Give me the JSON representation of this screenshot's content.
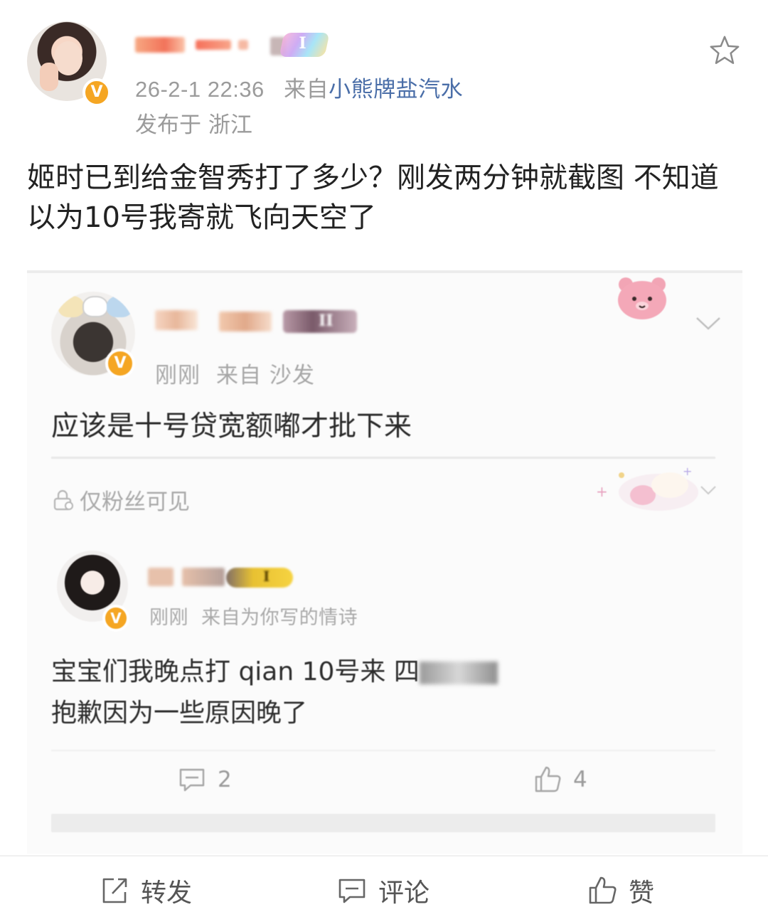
{
  "post": {
    "time": "26-2-1 22:36",
    "from_label": "来自",
    "source": "小熊牌盐汽水",
    "location": "发布于 浙江",
    "body": "姬时已到给金智秀打了多少？刚发两分钟就截图 不知道以为10号我寄就飞向天空了",
    "verified_badge": "V",
    "level_badge": "I"
  },
  "embedded": {
    "comment1": {
      "time": "刚刚",
      "source": "来自 沙发",
      "text": "应该是十号贷宽额嘟才批下来",
      "visibility": "仅粉丝可见",
      "level_badge": "II"
    },
    "comment2": {
      "time": "刚刚",
      "source": "来自为你写的情诗",
      "line1": "宝宝们我晚点打 qian 10号来 四",
      "line2": "抱歉因为一些原因晚了",
      "level_badge": "I",
      "comment_count": "2",
      "like_count": "4"
    }
  },
  "toolbar": {
    "repost": "转发",
    "comment": "评论",
    "like": "赞"
  },
  "colors": {
    "accent_link": "#4a6ea8",
    "verified": "#f5a623",
    "meta_gray": "#9b9b9b"
  },
  "icons": [
    "star-icon",
    "verified-icon",
    "bear-sticker-icon",
    "chevron-down-icon",
    "lock-icon",
    "comment-icon",
    "like-icon",
    "repost-icon"
  ]
}
